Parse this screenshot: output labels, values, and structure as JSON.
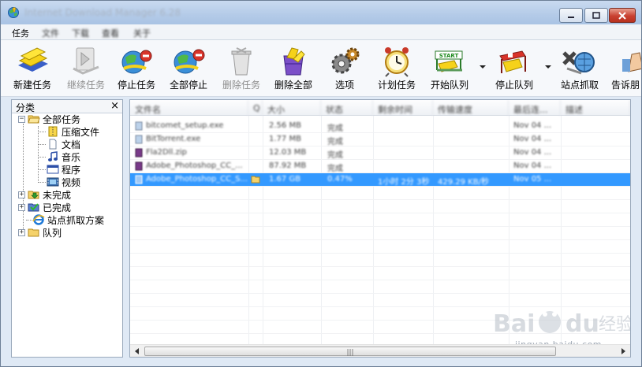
{
  "window": {
    "title": "Internet Download Manager 6.28"
  },
  "menu": [
    {
      "label": "任务",
      "blurred": false
    },
    {
      "label": "文件",
      "blurred": true
    },
    {
      "label": "下载",
      "blurred": true
    },
    {
      "label": "查看",
      "blurred": true
    },
    {
      "label": "关于",
      "blurred": true
    }
  ],
  "toolbar": {
    "new_task": "新建任务",
    "resume": "继续任务",
    "stop": "停止任务",
    "stop_all": "全部停止",
    "delete": "删除任务",
    "delete_all": "删除全部",
    "options": "选项",
    "scheduler": "计划任务",
    "start_queue": "开始队列",
    "start_badge": "START",
    "stop_queue": "停止队列",
    "site_grabber": "站点抓取",
    "tell_friend": "告诉朋"
  },
  "sidebar": {
    "title": "分类",
    "close": "×",
    "all_tasks": "全部任务",
    "items": [
      "压缩文件",
      "文档",
      "音乐",
      "程序",
      "视频"
    ],
    "unfinished": "未完成",
    "finished": "已完成",
    "site_grab": "站点抓取方案",
    "queues": "队列",
    "expand_minus": "−",
    "expand_plus": "+"
  },
  "list": {
    "columns": [
      "文件名",
      "Q",
      "大小",
      "状态",
      "剩余时间",
      "传输速度",
      "最后连...",
      "描述"
    ],
    "rows": [
      {
        "name": "bitcomet_setup.exe",
        "size": "2.56 MB",
        "status": "完成",
        "date": "Nov 04 ..."
      },
      {
        "name": "BitTorrent.exe",
        "size": "1.77 MB",
        "status": "完成",
        "date": "Nov 04 ..."
      },
      {
        "name": "Fla2Dll.zip",
        "size": "12.03 MB",
        "status": "完成",
        "date": "Nov 04 ..."
      },
      {
        "name": "Adobe_Photoshop_CC_...",
        "size": "87.92 MB",
        "status": "完成",
        "date": "Nov 04 ..."
      },
      {
        "name": "Adobe_Photoshop_CC_S...",
        "size": "1.67 GB",
        "status": "0.47%",
        "time": "1小时 2分 3秒",
        "speed": "429.29 KB/秒",
        "date": "Nov 05 ...",
        "selected": true
      }
    ],
    "scroll_grip": "|||"
  },
  "watermark": {
    "text": "jingyan.baidu.com"
  },
  "colors": {
    "selection": "#3399ff",
    "titlebar": "#b4cbe8",
    "close": "#c94030"
  }
}
